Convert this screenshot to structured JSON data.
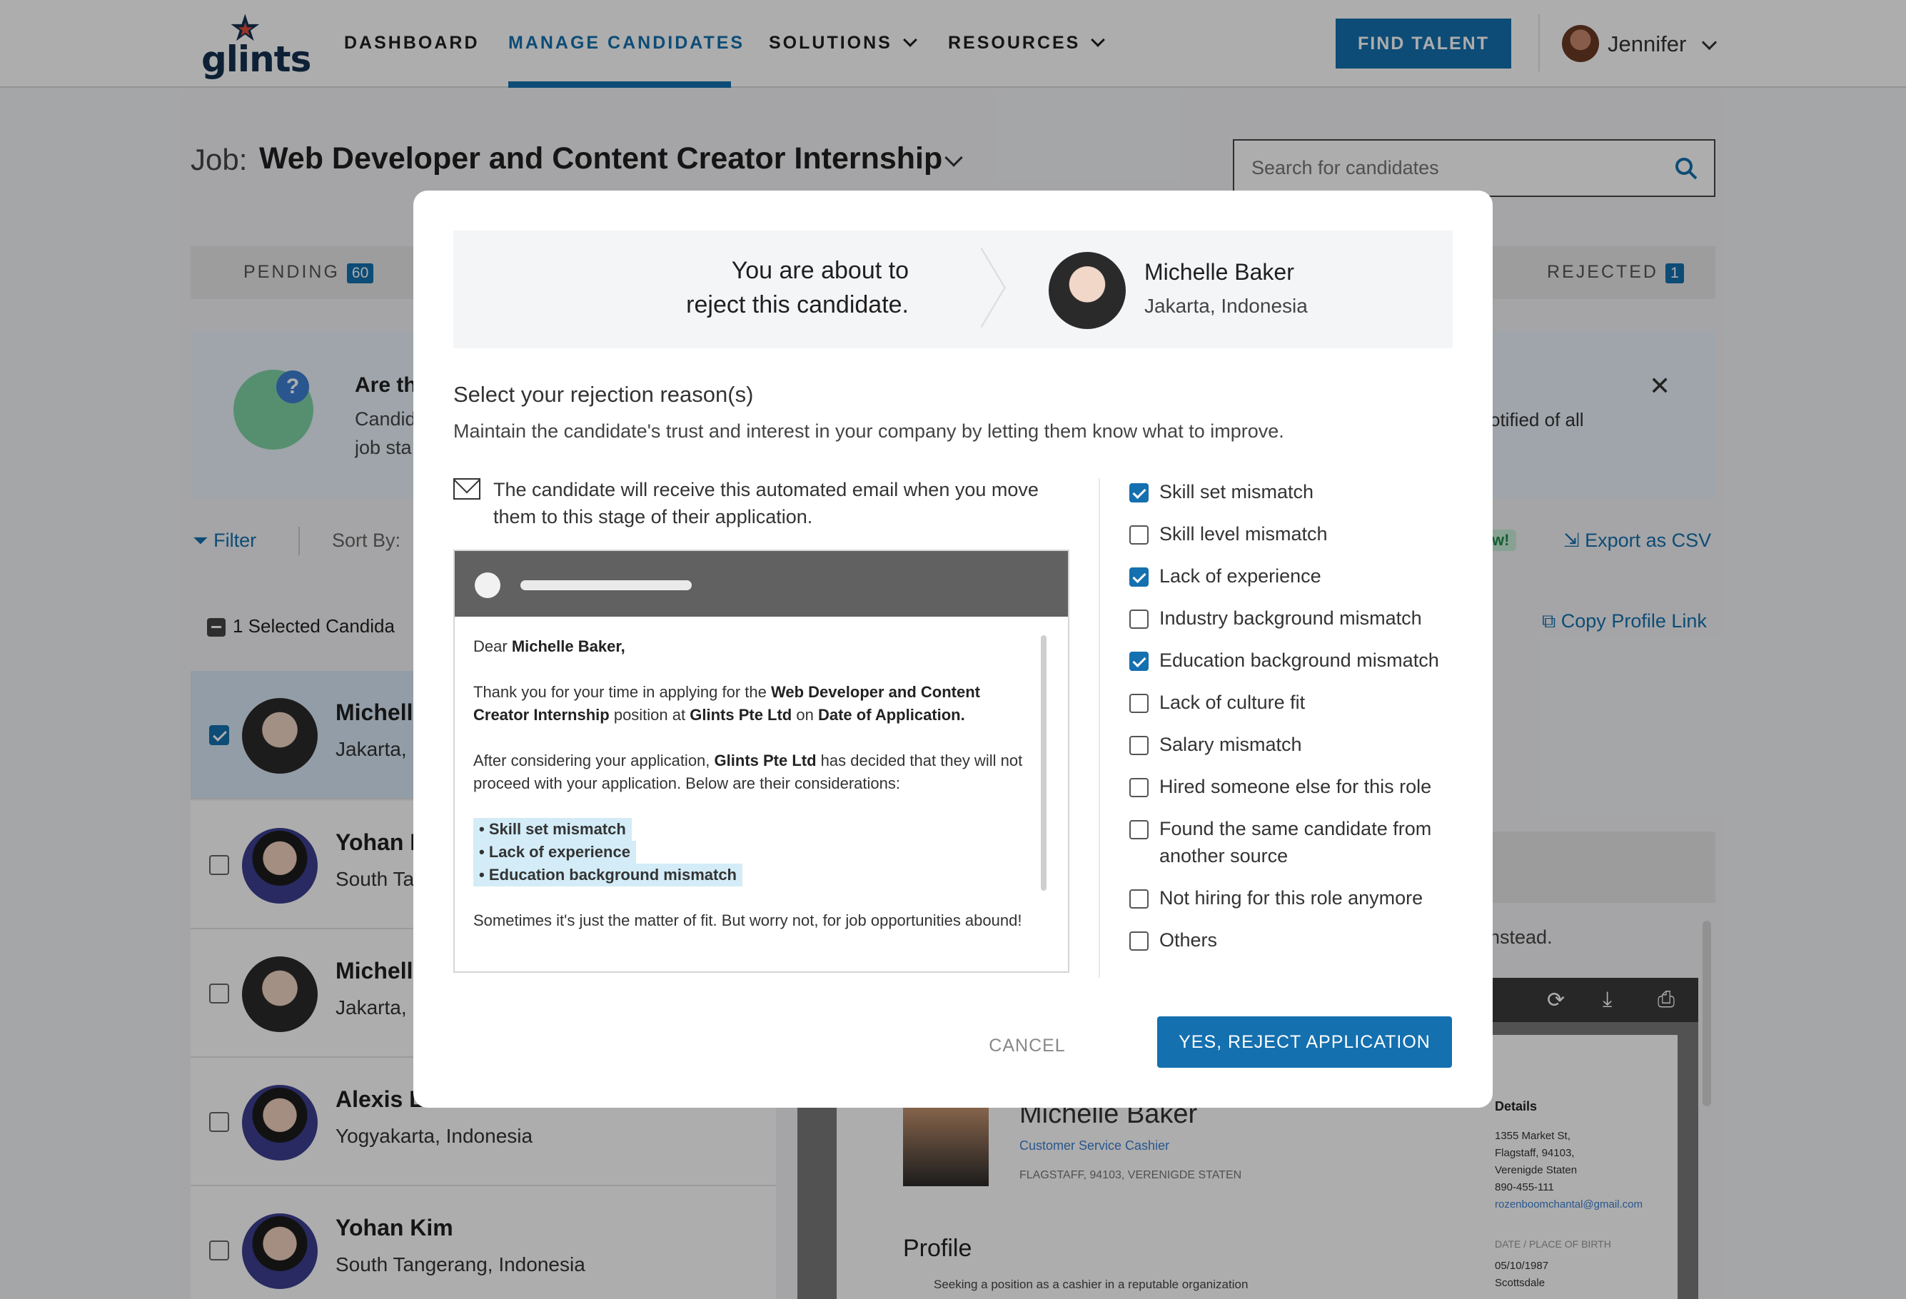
{
  "nav": {
    "logo_text": "glints",
    "items": [
      "DASHBOARD",
      "MANAGE CANDIDATES",
      "SOLUTIONS",
      "RESOURCES"
    ],
    "active_item": "MANAGE CANDIDATES",
    "find_talent": "FIND TALENT",
    "user_name": "Jennifer"
  },
  "job": {
    "label": "Job:",
    "title": "Web Developer and Content Creator Internship"
  },
  "search": {
    "placeholder": "Search for candidates"
  },
  "tabs": {
    "pending_label": "PENDING",
    "pending_count": "60",
    "rejected_label": "REJECTED",
    "rejected_count": "1"
  },
  "banner": {
    "title": "Are th",
    "text_line1": "Candid",
    "text_line2": "job sta",
    "tail": "otified of all"
  },
  "toolbar": {
    "filter": "Filter",
    "sort_by": "Sort By:",
    "new_badge": "w!",
    "export_csv": "Export as CSV",
    "copy_link": "Copy Profile Link",
    "selected": "1 Selected Candida"
  },
  "candidates": [
    {
      "name": "Michell",
      "location": "Jakarta,",
      "selected": true
    },
    {
      "name": "Yohan I",
      "location": "South Ta",
      "selected": false
    },
    {
      "name": "Michell",
      "location": "Jakarta,",
      "selected": false
    },
    {
      "name": "Alexis L",
      "location": "Yogyakarta, Indonesia",
      "selected": false
    },
    {
      "name": "Yohan Kim",
      "location": "South Tangerang, Indonesia",
      "selected": false
    }
  ],
  "resume": {
    "instead_text": "instead.",
    "name": "Michelle Baker",
    "role": "Customer Service Cashier",
    "address": "FLAGSTAFF, 94103, VERENIGDE STATEN",
    "profile_heading": "Profile",
    "profile_text": "Seeking a position as a cashier in a reputable organization",
    "details_heading": "Details",
    "details_lines": [
      "1355 Market St,",
      "Flagstaff, 94103,",
      "Verenigde Staten",
      "890-455-111"
    ],
    "email": "rozenboomchantal@gmail.com",
    "dob_heading": "DATE / PLACE OF BIRTH",
    "dob": "05/10/1987",
    "birthplace": "Scottsdale"
  },
  "modal": {
    "header_line1": "You are about to",
    "header_line2": "reject this candidate.",
    "candidate_name": "Michelle Baker",
    "candidate_location": "Jakarta, Indonesia",
    "select_title": "Select your rejection reason(s)",
    "select_subtitle": "Maintain the candidate's trust and interest in your company by letting them know what to improve.",
    "email_note": "The candidate will receive this automated email when you move them to this stage of their application.",
    "email": {
      "greeting_prefix": "Dear",
      "greeting_name": "Michelle Baker,",
      "p1_a": "Thank you for your time in applying for the",
      "p1_role": "Web Developer and Content Creator Internship",
      "p1_b": "position at",
      "p1_company": "Glints Pte Ltd",
      "p1_c": "on",
      "p1_date": "Date of Application.",
      "p2_a": "After considering your application,",
      "p2_company": "Glints Pte Ltd",
      "p2_b": "has decided that they will not proceed with your application. Below are their considerations:",
      "considerations": [
        "Skill set mismatch",
        "Lack of experience",
        "Education background mismatch"
      ],
      "p3": "Sometimes it's just the matter of fit. But worry not, for job opportunities abound!"
    },
    "reasons": [
      {
        "label": "Skill set mismatch",
        "checked": true
      },
      {
        "label": "Skill level mismatch",
        "checked": false
      },
      {
        "label": "Lack of experience",
        "checked": true
      },
      {
        "label": "Industry background mismatch",
        "checked": false
      },
      {
        "label": "Education background mismatch",
        "checked": true
      },
      {
        "label": "Lack of culture fit",
        "checked": false
      },
      {
        "label": "Salary mismatch",
        "checked": false
      },
      {
        "label": "Hired someone else for this role",
        "checked": false
      },
      {
        "label": "Found the same candidate from another source",
        "checked": false
      },
      {
        "label": "Not hiring for this role anymore",
        "checked": false
      },
      {
        "label": "Others",
        "checked": false
      }
    ],
    "cancel": "CANCEL",
    "confirm": "YES, REJECT APPLICATION"
  },
  "colors": {
    "primary": "#1470af",
    "overlay": "rgba(0,0,0,0.32)",
    "highlight": "#d3ecf7"
  }
}
